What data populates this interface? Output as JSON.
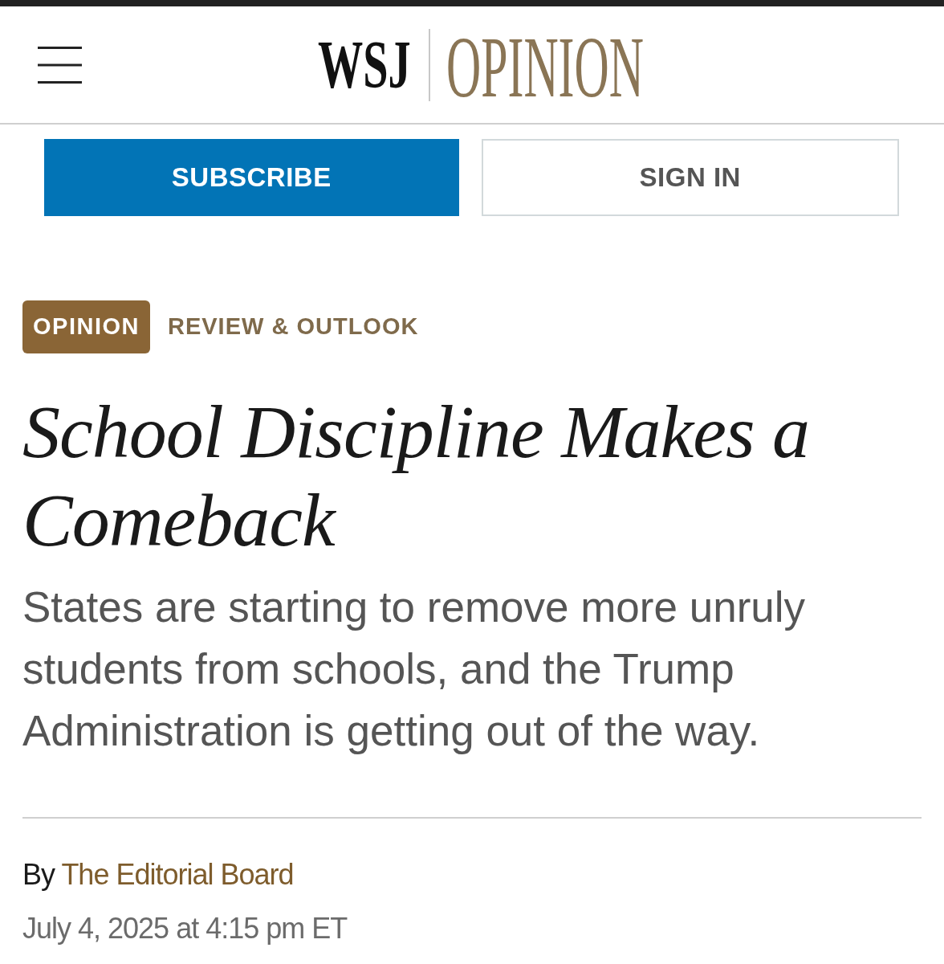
{
  "header": {
    "logo": "WSJ",
    "section": "OPINION"
  },
  "actions": [
    {
      "label": "SUBSCRIBE",
      "kind": "primary"
    },
    {
      "label": "SIGN IN",
      "kind": "outline"
    }
  ],
  "article": {
    "flag": "OPINION",
    "column": "REVIEW & OUTLOOK",
    "headline": "School Discipline Makes a Comeback",
    "deck": "States are starting to remove more unruly students from schools, and the Trump Administration is getting out of the way.",
    "byline": {
      "prefix": "By",
      "author": "The Editorial Board"
    },
    "timestamp": "July 4, 2025 at 4:15 pm ET"
  }
}
